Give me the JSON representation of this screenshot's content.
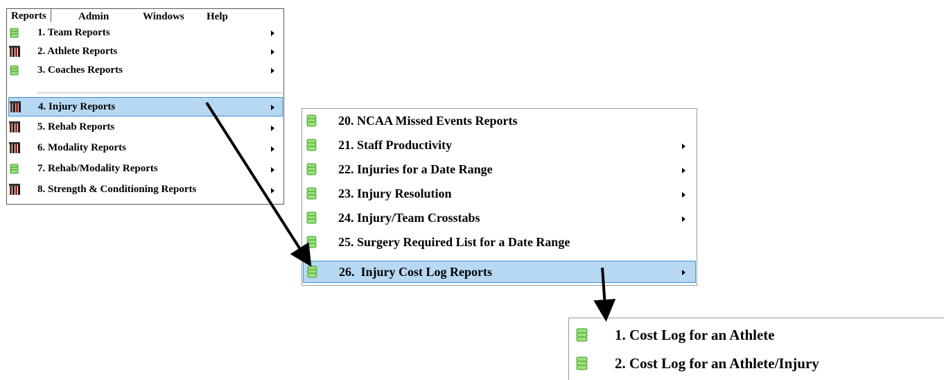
{
  "menubar": {
    "items": [
      {
        "label": "Reports"
      },
      {
        "label": "Admin"
      },
      {
        "label": "Windows"
      },
      {
        "label": "Help"
      }
    ]
  },
  "reports_menu": {
    "items": [
      {
        "label": "1. Team Reports",
        "icon": "stack-icon",
        "has_submenu": true
      },
      {
        "label": "2. Athlete Reports",
        "icon": "athletes-icon",
        "has_submenu": true
      },
      {
        "label": "3. Coaches Reports",
        "icon": "stack-icon",
        "has_submenu": true
      },
      {
        "label": "4. Injury Reports",
        "icon": "athletes-icon",
        "has_submenu": true,
        "highlighted": true
      },
      {
        "label": "5. Rehab Reports",
        "icon": "athletes-icon",
        "has_submenu": true
      },
      {
        "label": "6. Modality Reports",
        "icon": "athletes-icon",
        "has_submenu": true
      },
      {
        "label": "7. Rehab/Modality Reports",
        "icon": "stack-icon",
        "has_submenu": true
      },
      {
        "label": "8. Strength & Conditioning Reports",
        "icon": "athletes-icon",
        "has_submenu": true
      }
    ]
  },
  "injury_menu": {
    "items": [
      {
        "label": "20. NCAA Missed Events Reports",
        "icon": "stack-icon",
        "has_submenu": false
      },
      {
        "label": "21. Staff Productivity",
        "icon": "stack-icon",
        "has_submenu": true
      },
      {
        "label": "22. Injuries for a Date Range",
        "icon": "stack-icon",
        "has_submenu": true
      },
      {
        "label": "23. Injury Resolution",
        "icon": "stack-icon",
        "has_submenu": true
      },
      {
        "label": "24. Injury/Team Crosstabs",
        "icon": "stack-icon",
        "has_submenu": true
      },
      {
        "label": "25. Surgery Required List for a Date Range",
        "icon": "stack-icon",
        "has_submenu": false
      },
      {
        "label": "26.  Injury Cost Log Reports",
        "icon": "stack-icon",
        "has_submenu": true,
        "highlighted": true
      }
    ]
  },
  "cost_log_menu": {
    "items": [
      {
        "label": "1. Cost Log for an Athlete",
        "icon": "stack-icon"
      },
      {
        "label": "2. Cost Log for an Athlete/Injury",
        "icon": "stack-icon"
      }
    ]
  },
  "colors": {
    "highlight_bg": "#b7d8f3",
    "highlight_border": "#3d8fd6",
    "stack_icon_fill": "#9be07a",
    "stack_icon_stroke": "#3f9a2c"
  }
}
